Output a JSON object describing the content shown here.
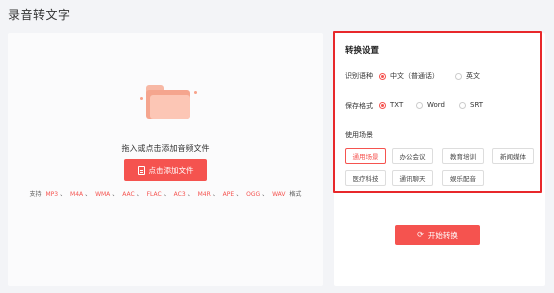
{
  "page": {
    "title": "录音转文字"
  },
  "upload": {
    "hint": "拖入或点击添加音频文件",
    "add_button": "点击添加文件",
    "formats_prefix": "支持",
    "formats": [
      "MP3",
      "M4A",
      "WMA",
      "AAC",
      "FLAC",
      "AC3",
      "M4R",
      "APE",
      "OGG",
      "WAV"
    ],
    "formats_suffix": "格式"
  },
  "settings": {
    "title": "转换设置",
    "language": {
      "label": "识别语种",
      "options": [
        "中文（普通话）",
        "英文"
      ],
      "selected": "中文（普通话）"
    },
    "format": {
      "label": "保存格式",
      "options": [
        "TXT",
        "Word",
        "SRT"
      ],
      "selected": "TXT"
    },
    "scene": {
      "label": "使用场景",
      "options": [
        "通用场景",
        "办公会议",
        "教育培训",
        "新闻媒体",
        "医疗科技",
        "通讯聊天",
        "娱乐配音"
      ],
      "selected": "通用场景"
    },
    "start_button": "开始转换"
  },
  "colors": {
    "accent": "#f5534f",
    "highlight_border": "#e8282b"
  }
}
